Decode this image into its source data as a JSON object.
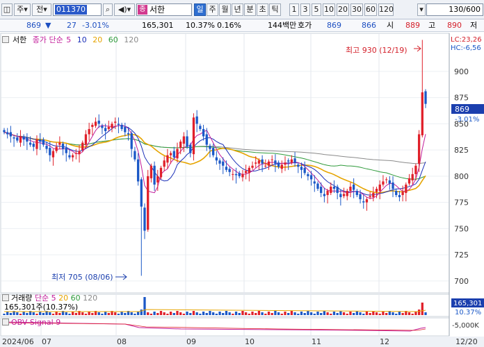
{
  "toolbar": {
    "mode_label": "주",
    "jeon_label": "전",
    "code_value": "011370",
    "stock_tag": "종",
    "stock_name": "서한",
    "periods": [
      "일",
      "주",
      "월",
      "년",
      "분",
      "초",
      "틱"
    ],
    "active_period": "일",
    "intervals": [
      "1",
      "3",
      "5",
      "10",
      "20",
      "30",
      "60",
      "120"
    ],
    "count_value": "130/600"
  },
  "quote": {
    "price": "869",
    "change": "27",
    "change_pct": "-3.01%",
    "volume": "165,301",
    "volume_ratio": "10.37%",
    "turnover": "0.16%",
    "amount": "144백만",
    "hoga_label": "호가",
    "bid": "869",
    "ask": "866",
    "open_label": "시",
    "open": "889",
    "high_label": "고",
    "high": "890",
    "low_label": "저"
  },
  "price_pane": {
    "stock_name": "서한",
    "ma_label": "종가 단순",
    "ma_periods": [
      "5",
      "10",
      "20",
      "60",
      "120"
    ],
    "lc_label": "LC:23,26",
    "hc_label": "HC:-6,56",
    "high_annotation": "최고 930 (12/19)",
    "low_annotation": "최저 705 (08/06)",
    "current_price_tag": "869",
    "current_change_tag": "-3.01%",
    "y_ticks": [
      "900",
      "875",
      "850",
      "825",
      "800",
      "775",
      "750",
      "725",
      "700"
    ]
  },
  "volume_pane": {
    "label": "거래량",
    "ma_label": "단순",
    "ma_periods": [
      "5",
      "20",
      "60",
      "120"
    ],
    "current": "165,301주(10.37%)",
    "tag_value": "165,301",
    "tag_pct": "10.37%"
  },
  "obv_pane": {
    "label": "OBV",
    "signal_label": "Signal 9",
    "tick": "-5,000K"
  },
  "x_axis": {
    "labels": [
      "2024/06",
      "07",
      "08",
      "09",
      "10",
      "11",
      "12",
      "12/20"
    ]
  },
  "colors": {
    "up": "#e0202a",
    "down": "#1b58c7",
    "ma5": "#c21c9a",
    "ma10": "#1b2fb8",
    "ma20": "#e6a400",
    "ma60": "#2e9a3a",
    "ma120": "#8a8a8a"
  },
  "chart_data": {
    "type": "candlestick",
    "title": "서한",
    "y_range": [
      690,
      935
    ],
    "key_points": [
      {
        "x": "08/06",
        "low": 705,
        "label": "최저 705 (08/06)"
      },
      {
        "x": "12/19",
        "high": 930,
        "label": "최고 930 (12/19)"
      },
      {
        "x": "12/20",
        "close": 869,
        "change_pct": "-3.01%"
      }
    ],
    "close_series": [
      842,
      840,
      838,
      836,
      834,
      838,
      835,
      833,
      830,
      828,
      835,
      833,
      830,
      826,
      820,
      824,
      828,
      832,
      826,
      822,
      818,
      820,
      822,
      824,
      832,
      840,
      845,
      849,
      852,
      850,
      846,
      843,
      847,
      850,
      852,
      849,
      845,
      842,
      840,
      826,
      816,
      795,
      771,
      748,
      800,
      810,
      792,
      800,
      808,
      815,
      820,
      822,
      818,
      826,
      833,
      838,
      828,
      822,
      856,
      850,
      845,
      838,
      830,
      826,
      820,
      815,
      812,
      810,
      806,
      804,
      802,
      801,
      800,
      802,
      805,
      808,
      810,
      813,
      815,
      812,
      810,
      814,
      816,
      812,
      809,
      811,
      813,
      814,
      816,
      813,
      809,
      806,
      803,
      800,
      797,
      793,
      788,
      784,
      781,
      786,
      790,
      788,
      784,
      780,
      783,
      786,
      790,
      787,
      782,
      778,
      775,
      778,
      781,
      784,
      788,
      792,
      795,
      797,
      793,
      788,
      782,
      780,
      785,
      792,
      798,
      802,
      810,
      840,
      880,
      869
    ],
    "volume_spikes": [
      {
        "x": "08/07",
        "relative": 1.0
      },
      {
        "x": "12/19",
        "relative": 0.7
      }
    ]
  }
}
